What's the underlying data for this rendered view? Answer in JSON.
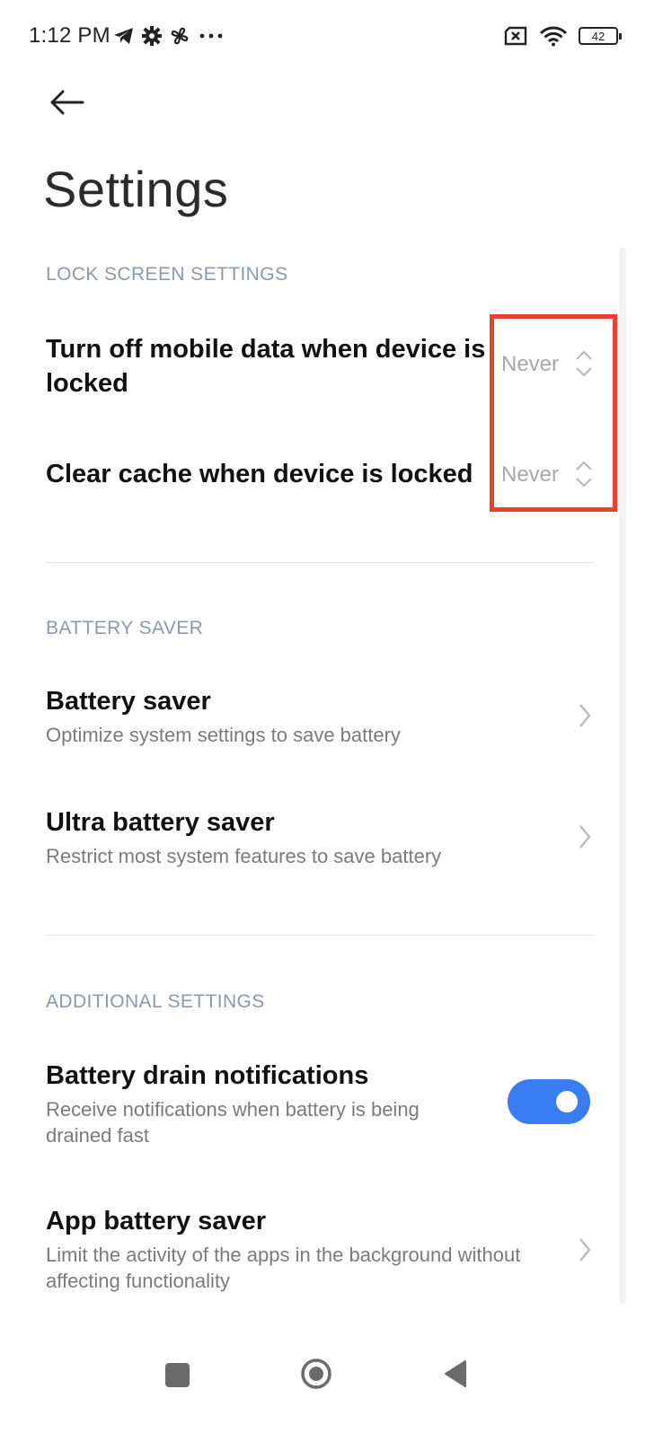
{
  "status_bar": {
    "time": "1:12 PM",
    "left_icons": [
      "telegram-icon",
      "gear-icon",
      "fan-icon",
      "more-icon"
    ],
    "right_icons": [
      "no-sim-icon",
      "wifi-icon"
    ],
    "battery_level": "42"
  },
  "header": {
    "back_icon": "arrow-left-icon",
    "title": "Settings"
  },
  "sections": {
    "lock_screen": {
      "header": "LOCK SCREEN SETTINGS",
      "items": [
        {
          "title": "Turn off mobile data when device is locked",
          "value": "Never"
        },
        {
          "title": "Clear cache when device is locked",
          "value": "Never"
        }
      ]
    },
    "battery_saver": {
      "header": "BATTERY SAVER",
      "items": [
        {
          "title": "Battery saver",
          "subtitle": "Optimize system settings to save battery"
        },
        {
          "title": "Ultra battery saver",
          "subtitle": "Restrict most system features to save battery"
        }
      ]
    },
    "additional": {
      "header": "ADDITIONAL SETTINGS",
      "items": [
        {
          "title": "Battery drain notifications",
          "subtitle": "Receive notifications when battery is being drained fast",
          "toggle_on": true
        },
        {
          "title": "App battery saver",
          "subtitle": "Limit the activity of the apps in the background without affecting functionality"
        }
      ]
    }
  },
  "colors": {
    "accent": "#3a7df2",
    "highlight_border": "#e8412e",
    "section_header": "#8c98ab",
    "secondary_text": "#7b7b7b"
  },
  "nav_bar": {
    "icons": [
      "recents-square-icon",
      "home-circle-icon",
      "back-triangle-icon"
    ]
  }
}
